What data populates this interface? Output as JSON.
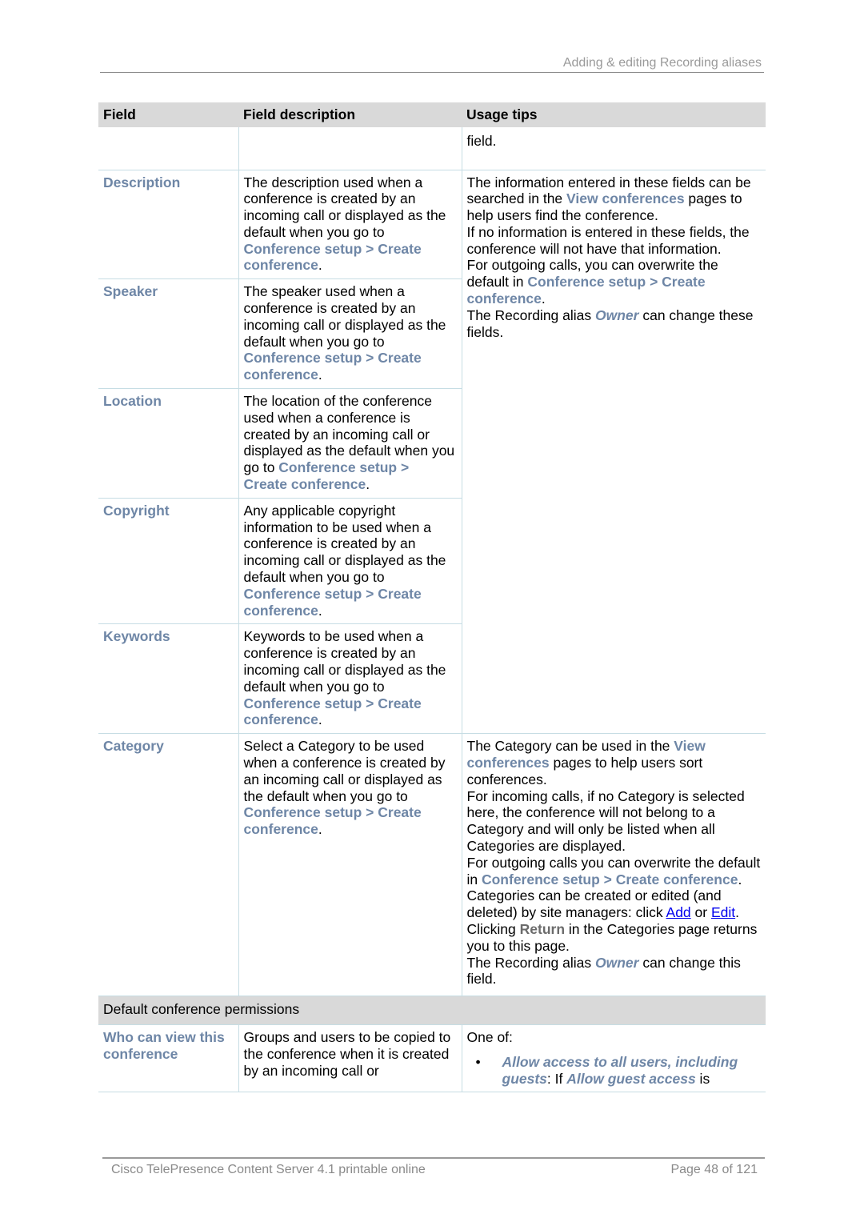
{
  "header": {
    "section_title": "Adding & editing Recording aliases"
  },
  "table": {
    "columns": [
      "Field",
      "Field description",
      "Usage tips"
    ],
    "continued_row": {
      "field": "",
      "description": "",
      "tips": "field."
    },
    "shared_tips_group1": {
      "p1_a": "The information entered in these fields can be searched in the ",
      "p1_ref": "View conferences",
      "p1_b": " pages to help users find the conference.",
      "p2": "If no information is entered in these fields, the conference will not have that information.",
      "p3_a": "For outgoing calls, you can overwrite the default in ",
      "p3_ref": "Conference setup > Create conference",
      "p3_b": ".",
      "p4_a": "The Recording alias ",
      "p4_em": "Owner",
      "p4_b": " can change these fields."
    },
    "rows": [
      {
        "field": "Description",
        "desc_a": "The description used when a conference is created by an incoming call or displayed as the default when you go to ",
        "desc_ref": "Conference setup > Create conference",
        "desc_b": "."
      },
      {
        "field": "Speaker",
        "desc_a": "The speaker used when a conference is created by an incoming call or displayed as the default when you go to ",
        "desc_ref": "Conference setup > Create conference",
        "desc_b": "."
      },
      {
        "field": "Location",
        "desc_a": "The location of the conference used when a conference is created by an incoming call or displayed as the default when you go to ",
        "desc_ref": "Conference setup > Create conference",
        "desc_b": "."
      },
      {
        "field": "Copyright",
        "desc_a": "Any applicable copyright information to be used when a conference is created by an incoming call or displayed as the default when you go to ",
        "desc_ref": "Conference setup > Create conference",
        "desc_b": "."
      },
      {
        "field": "Keywords",
        "desc_a": "Keywords to be used when a conference is created by an incoming call or displayed as the default when you go to ",
        "desc_ref": "Conference setup > Create conference",
        "desc_b": "."
      },
      {
        "field": "Category",
        "desc_a": "Select a Category to be used when a conference is created by an incoming call or displayed as the default when you go to ",
        "desc_ref": "Conference setup > Create conference",
        "desc_b": "."
      }
    ],
    "category_tips": {
      "p1_a": "The Category can be used in the ",
      "p1_ref": "View conferences",
      "p1_b": " pages to help users sort conferences.",
      "p2": "For incoming calls, if no Category is selected here, the conference will not belong to a Category and will only be listed when all Categories are displayed.",
      "p3_a": "For outgoing calls you can overwrite the default in ",
      "p3_ref": "Conference setup > Create conference",
      "p3_b": ".",
      "p4_a": "Categories can be created or edited (and deleted) by site managers: click ",
      "p4_link1": "Add",
      "p4_mid": " or ",
      "p4_link2": "Edit",
      "p4_b": ".",
      "p5_a": "Clicking ",
      "p5_btn": "Return",
      "p5_b": " in the Categories page returns you to this page.",
      "p6_a": "The Recording alias ",
      "p6_em": "Owner",
      "p6_b": " can change this field."
    },
    "section_header": "Default conference permissions",
    "permissions_row": {
      "field": "Who can view this conference",
      "description": "Groups and users to be copied to the conference when it is created by an incoming call or",
      "tips_intro": "One of:",
      "bullet1_em1": "Allow access to all users, including guests",
      "bullet1_text1": ": If ",
      "bullet1_em2": "Allow guest access",
      "bullet1_text2": " is"
    }
  },
  "footer": {
    "product": "Cisco TelePresence Content Server 4.1 printable online",
    "page": "Page 48 of 121"
  }
}
